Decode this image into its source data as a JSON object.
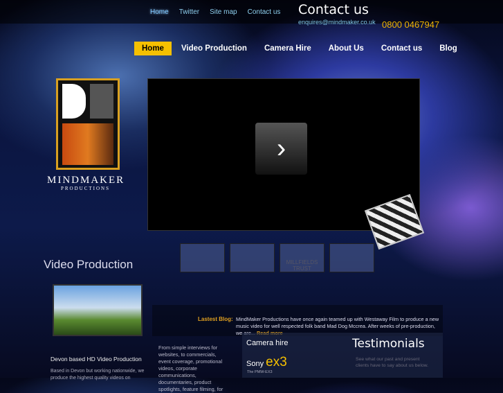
{
  "top_links": [
    "Home",
    "Twitter",
    "Site map",
    "Contact us"
  ],
  "contact": {
    "title": "Contact us",
    "email": "enquires@mindmaker.co.uk",
    "phone": "0800 0467947"
  },
  "nav": [
    "Home",
    "Video Production",
    "Camera Hire",
    "About Us",
    "Contact us",
    "Blog"
  ],
  "logo": {
    "name": "MINDMAKER",
    "sub": "PRODUCTIONS"
  },
  "player": {
    "play_icon": "chevron-right"
  },
  "thumbnails": [
    "",
    "",
    "MILLFIELDS TRUST",
    ""
  ],
  "video_production": {
    "heading": "Video Production",
    "subheading": "Devon based HD Video Production",
    "text": "Based in Devon but working nationwide, we produce the highest quality videos on"
  },
  "blog": {
    "label": "Lastest Blog:",
    "text": "MindMaker Productions have once again teamed up with Westaway Film to produce a new music video for well respected folk band Mad Dog Mccrea. After weeks of pre-production, we are...",
    "read_more": "Read more"
  },
  "services_text": "From simple interviews for websites, to commercials, event coverage, promotional videos, corporate communications, documentaries, product spotlights, feature filming, for",
  "camera_hire": {
    "heading": "Camera hire",
    "brand": "Sony",
    "model": "ex3",
    "desc": "The PMW-EX3"
  },
  "testimonials": {
    "heading": "Testimonials",
    "text": "See what our past and present clients have to say about us below."
  }
}
